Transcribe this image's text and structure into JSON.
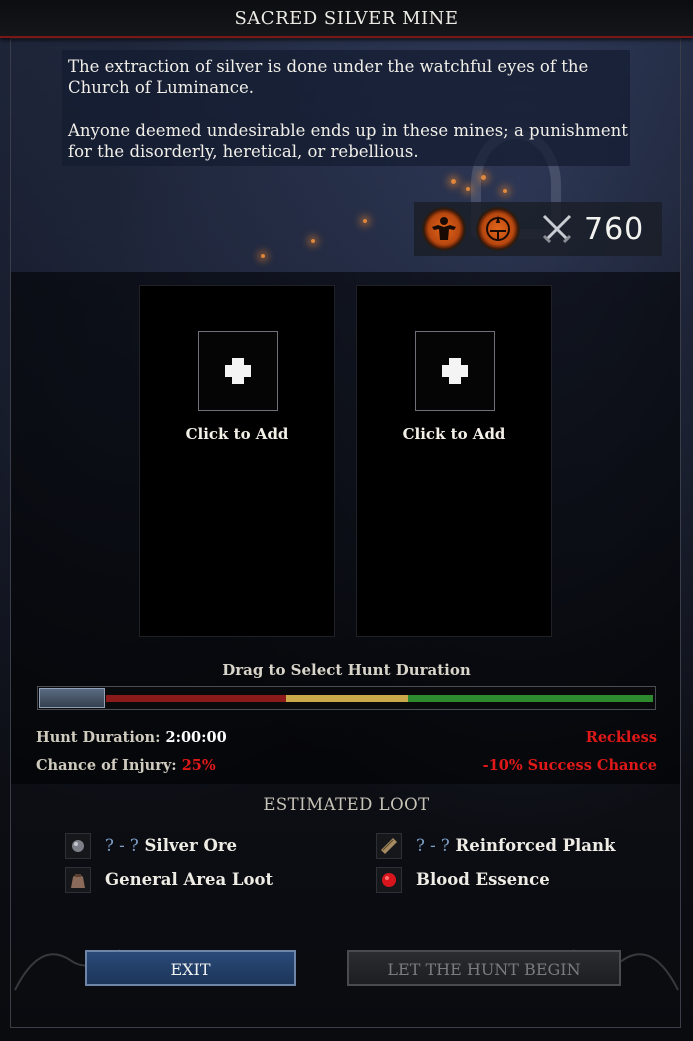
{
  "window": {
    "title": "SACRED SILVER MINE"
  },
  "description": {
    "paragraph1": "The extraction of silver is done under the watchful eyes of the Church of Luminance.",
    "paragraph2": "Anyone deemed undesirable ends up in these mines; a punishment for the disorderly, heretical, or rebellious."
  },
  "power": {
    "icons": [
      "strength-figure-icon",
      "sun-emblem-icon",
      "crossed-swords-icon"
    ],
    "value": "760"
  },
  "slots": [
    {
      "label": "Click to Add",
      "icon": "plus-icon"
    },
    {
      "label": "Click to Add",
      "icon": "plus-icon"
    }
  ],
  "duration": {
    "instruction": "Drag to Select Hunt Duration",
    "selected_fraction": 0.0,
    "segment_colors": [
      "#8b1a1a",
      "#c9a94a",
      "#2e8a2e"
    ],
    "hunt_duration_label": "Hunt Duration:",
    "hunt_duration_value": "2:00:00",
    "injury_label": "Chance of Injury:",
    "injury_value": "25%",
    "risk_label": "Reckless",
    "success_modifier": "-10% Success Chance"
  },
  "loot": {
    "title": "ESTIMATED LOOT",
    "items": [
      {
        "quantity": "? - ?",
        "name": "Silver Ore",
        "icon": "silver-ore-icon"
      },
      {
        "quantity": "? - ?",
        "name": "Reinforced Plank",
        "icon": "plank-icon"
      },
      {
        "quantity": "",
        "name": "General Area Loot",
        "icon": "loot-bag-icon"
      },
      {
        "quantity": "",
        "name": "Blood Essence",
        "icon": "blood-essence-icon"
      }
    ]
  },
  "buttons": {
    "exit": "EXIT",
    "begin": "LET THE HUNT BEGIN"
  },
  "colors": {
    "accent_red": "#e01818",
    "title_border": "#7c1717",
    "exit_button": "#2a4a78"
  }
}
